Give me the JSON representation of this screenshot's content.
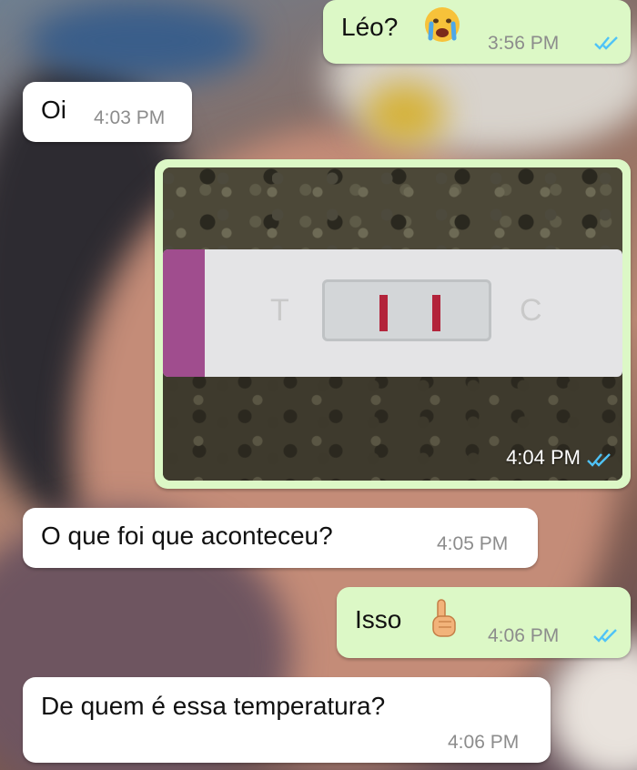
{
  "messages": [
    {
      "id": "m1",
      "direction": "outgoing",
      "text": "Léo?",
      "emoji": "crying-face-icon",
      "time": "3:56 PM",
      "read": true
    },
    {
      "id": "m2",
      "direction": "incoming",
      "text": "Oi",
      "time": "4:03 PM"
    },
    {
      "id": "m3",
      "direction": "outgoing",
      "type": "image",
      "image_subject": "pregnancy-test-photo",
      "time": "4:04 PM",
      "read": true,
      "test_labels": {
        "left": "T",
        "right": "C"
      }
    },
    {
      "id": "m4",
      "direction": "incoming",
      "text": "O que foi que aconteceu?",
      "time": "4:05 PM"
    },
    {
      "id": "m5",
      "direction": "outgoing",
      "text": "Isso",
      "emoji": "pointing-up-hand-icon",
      "time": "4:06 PM",
      "read": true
    },
    {
      "id": "m6",
      "direction": "incoming",
      "text": "De quem é essa temperatura?",
      "time": "4:06 PM"
    }
  ],
  "colors": {
    "outgoing_bubble": "#dcf8c6",
    "incoming_bubble": "#ffffff",
    "read_ticks": "#4fc3f7",
    "time_text": "#8c8c8c"
  }
}
